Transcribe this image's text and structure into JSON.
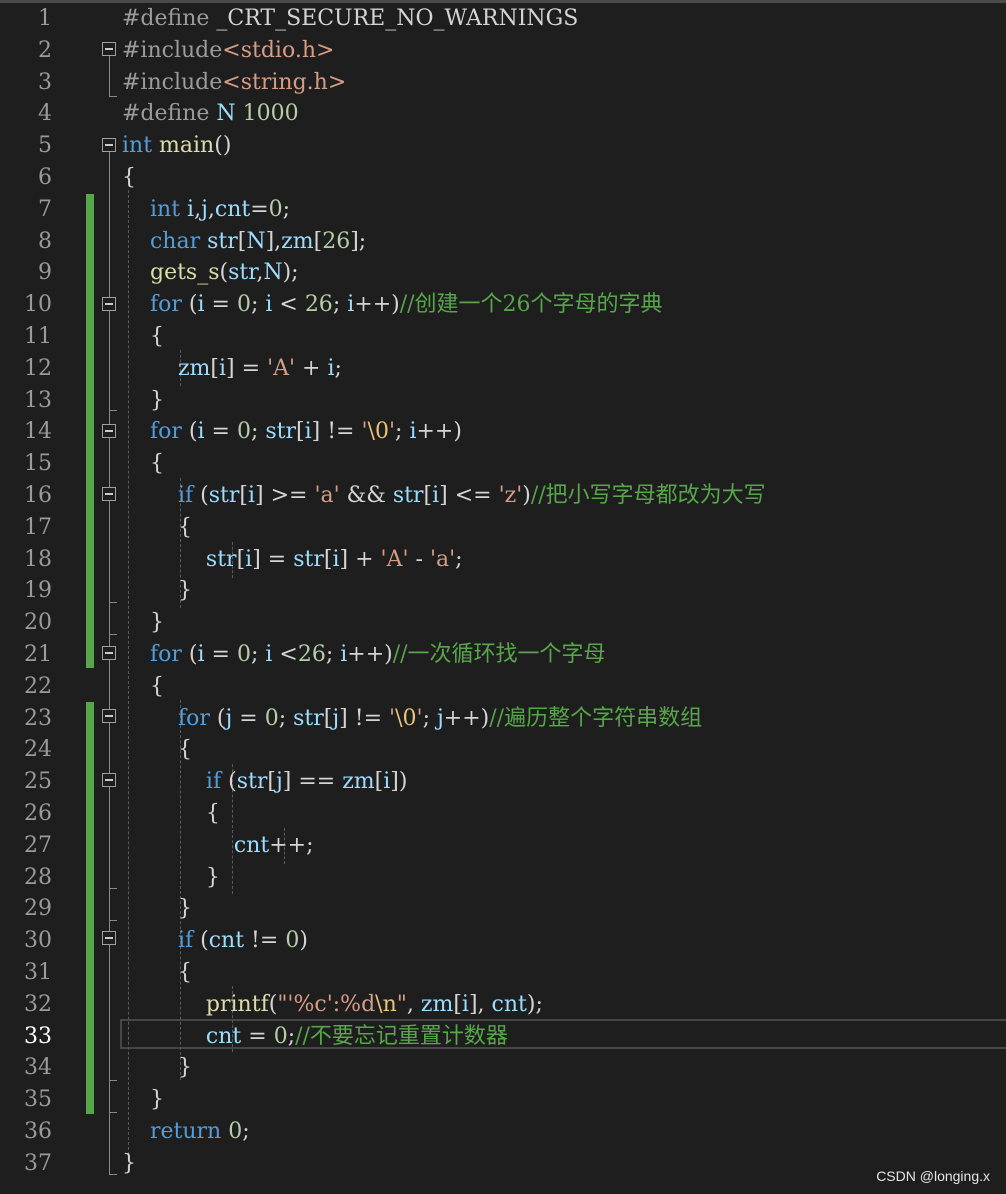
{
  "editor": {
    "current_line": 33,
    "lines": [
      {
        "num": "1",
        "tokens": [
          [
            "pp",
            "#define "
          ],
          [
            "op",
            "_CRT_SECURE_NO_WARNINGS"
          ]
        ]
      },
      {
        "num": "2",
        "tokens": [
          [
            "pp",
            "#include"
          ],
          [
            "str",
            "<stdio.h>"
          ]
        ]
      },
      {
        "num": "3",
        "tokens": [
          [
            "pp",
            "#include"
          ],
          [
            "str",
            "<string.h>"
          ]
        ]
      },
      {
        "num": "4",
        "tokens": [
          [
            "pp",
            "#define "
          ],
          [
            "var",
            "N"
          ],
          [
            "num",
            " 1000"
          ]
        ]
      },
      {
        "num": "5",
        "tokens": [
          [
            "kw",
            "int"
          ],
          [
            "fn",
            " main"
          ],
          [
            "op",
            "()"
          ]
        ]
      },
      {
        "num": "6",
        "tokens": [
          [
            "op",
            "{"
          ]
        ]
      },
      {
        "num": "7",
        "tokens": [
          [
            "op",
            "    "
          ],
          [
            "kw",
            "int"
          ],
          [
            "var",
            " i"
          ],
          [
            "op",
            ","
          ],
          [
            "var",
            "j"
          ],
          [
            "op",
            ","
          ],
          [
            "var",
            "cnt"
          ],
          [
            "op",
            "="
          ],
          [
            "num",
            "0"
          ],
          [
            "op",
            ";"
          ]
        ]
      },
      {
        "num": "8",
        "tokens": [
          [
            "op",
            "    "
          ],
          [
            "kw",
            "char"
          ],
          [
            "var",
            " str"
          ],
          [
            "op",
            "["
          ],
          [
            "var",
            "N"
          ],
          [
            "op",
            "],"
          ],
          [
            "var",
            "zm"
          ],
          [
            "op",
            "["
          ],
          [
            "num",
            "26"
          ],
          [
            "op",
            "];"
          ]
        ]
      },
      {
        "num": "9",
        "tokens": [
          [
            "op",
            "    "
          ],
          [
            "fn",
            "gets_s"
          ],
          [
            "op",
            "("
          ],
          [
            "var",
            "str"
          ],
          [
            "op",
            ","
          ],
          [
            "var",
            "N"
          ],
          [
            "op",
            ");"
          ]
        ]
      },
      {
        "num": "10",
        "tokens": [
          [
            "op",
            "    "
          ],
          [
            "kw",
            "for"
          ],
          [
            "op",
            " ("
          ],
          [
            "var",
            "i"
          ],
          [
            "op",
            " = "
          ],
          [
            "num",
            "0"
          ],
          [
            "op",
            "; "
          ],
          [
            "var",
            "i"
          ],
          [
            "op",
            " < "
          ],
          [
            "num",
            "26"
          ],
          [
            "op",
            "; "
          ],
          [
            "var",
            "i"
          ],
          [
            "op",
            "++)"
          ],
          [
            "cm",
            "//创建一个26个字母的字典"
          ]
        ]
      },
      {
        "num": "11",
        "tokens": [
          [
            "op",
            "    {"
          ]
        ]
      },
      {
        "num": "12",
        "tokens": [
          [
            "op",
            "        "
          ],
          [
            "var",
            "zm"
          ],
          [
            "op",
            "["
          ],
          [
            "var",
            "i"
          ],
          [
            "op",
            "] = "
          ],
          [
            "str",
            "'A'"
          ],
          [
            "op",
            " + "
          ],
          [
            "var",
            "i"
          ],
          [
            "op",
            ";"
          ]
        ]
      },
      {
        "num": "13",
        "tokens": [
          [
            "op",
            "    }"
          ]
        ]
      },
      {
        "num": "14",
        "tokens": [
          [
            "op",
            "    "
          ],
          [
            "kw",
            "for"
          ],
          [
            "op",
            " ("
          ],
          [
            "var",
            "i"
          ],
          [
            "op",
            " = "
          ],
          [
            "num",
            "0"
          ],
          [
            "op",
            "; "
          ],
          [
            "var",
            "str"
          ],
          [
            "op",
            "["
          ],
          [
            "var",
            "i"
          ],
          [
            "op",
            "] != "
          ],
          [
            "str",
            "'"
          ],
          [
            "esc",
            "\\0"
          ],
          [
            "str",
            "'"
          ],
          [
            "op",
            "; "
          ],
          [
            "var",
            "i"
          ],
          [
            "op",
            "++)"
          ]
        ]
      },
      {
        "num": "15",
        "tokens": [
          [
            "op",
            "    {"
          ]
        ]
      },
      {
        "num": "16",
        "tokens": [
          [
            "op",
            "        "
          ],
          [
            "kw",
            "if"
          ],
          [
            "op",
            " ("
          ],
          [
            "var",
            "str"
          ],
          [
            "op",
            "["
          ],
          [
            "var",
            "i"
          ],
          [
            "op",
            "] >= "
          ],
          [
            "str",
            "'a'"
          ],
          [
            "op",
            " && "
          ],
          [
            "var",
            "str"
          ],
          [
            "op",
            "["
          ],
          [
            "var",
            "i"
          ],
          [
            "op",
            "] <= "
          ],
          [
            "str",
            "'z'"
          ],
          [
            "op",
            ")"
          ],
          [
            "cm",
            "//把小写字母都改为大写"
          ]
        ]
      },
      {
        "num": "17",
        "tokens": [
          [
            "op",
            "        {"
          ]
        ]
      },
      {
        "num": "18",
        "tokens": [
          [
            "op",
            "            "
          ],
          [
            "var",
            "str"
          ],
          [
            "op",
            "["
          ],
          [
            "var",
            "i"
          ],
          [
            "op",
            "] = "
          ],
          [
            "var",
            "str"
          ],
          [
            "op",
            "["
          ],
          [
            "var",
            "i"
          ],
          [
            "op",
            "] + "
          ],
          [
            "str",
            "'A'"
          ],
          [
            "op",
            " - "
          ],
          [
            "str",
            "'a'"
          ],
          [
            "op",
            ";"
          ]
        ]
      },
      {
        "num": "19",
        "tokens": [
          [
            "op",
            "        }"
          ]
        ]
      },
      {
        "num": "20",
        "tokens": [
          [
            "op",
            "    }"
          ]
        ]
      },
      {
        "num": "21",
        "tokens": [
          [
            "op",
            "    "
          ],
          [
            "kw",
            "for"
          ],
          [
            "op",
            " ("
          ],
          [
            "var",
            "i"
          ],
          [
            "op",
            " = "
          ],
          [
            "num",
            "0"
          ],
          [
            "op",
            "; "
          ],
          [
            "var",
            "i"
          ],
          [
            "op",
            " <"
          ],
          [
            "num",
            "26"
          ],
          [
            "op",
            "; "
          ],
          [
            "var",
            "i"
          ],
          [
            "op",
            "++)"
          ],
          [
            "cm",
            "//一次循环找一个字母"
          ]
        ]
      },
      {
        "num": "22",
        "tokens": [
          [
            "op",
            "    {"
          ]
        ]
      },
      {
        "num": "23",
        "tokens": [
          [
            "op",
            "        "
          ],
          [
            "kw",
            "for"
          ],
          [
            "op",
            " ("
          ],
          [
            "var",
            "j"
          ],
          [
            "op",
            " = "
          ],
          [
            "num",
            "0"
          ],
          [
            "op",
            "; "
          ],
          [
            "var",
            "str"
          ],
          [
            "op",
            "["
          ],
          [
            "var",
            "j"
          ],
          [
            "op",
            "] != "
          ],
          [
            "str",
            "'"
          ],
          [
            "esc",
            "\\0"
          ],
          [
            "str",
            "'"
          ],
          [
            "op",
            "; "
          ],
          [
            "var",
            "j"
          ],
          [
            "op",
            "++)"
          ],
          [
            "cm",
            "//遍历整个字符串数组"
          ]
        ]
      },
      {
        "num": "24",
        "tokens": [
          [
            "op",
            "        {"
          ]
        ]
      },
      {
        "num": "25",
        "tokens": [
          [
            "op",
            "            "
          ],
          [
            "kw",
            "if"
          ],
          [
            "op",
            " ("
          ],
          [
            "var",
            "str"
          ],
          [
            "op",
            "["
          ],
          [
            "var",
            "j"
          ],
          [
            "op",
            "] == "
          ],
          [
            "var",
            "zm"
          ],
          [
            "op",
            "["
          ],
          [
            "var",
            "i"
          ],
          [
            "op",
            "])"
          ]
        ]
      },
      {
        "num": "26",
        "tokens": [
          [
            "op",
            "            {"
          ]
        ]
      },
      {
        "num": "27",
        "tokens": [
          [
            "op",
            "                "
          ],
          [
            "var",
            "cnt"
          ],
          [
            "op",
            "++;"
          ]
        ]
      },
      {
        "num": "28",
        "tokens": [
          [
            "op",
            "            }"
          ]
        ]
      },
      {
        "num": "29",
        "tokens": [
          [
            "op",
            "        }"
          ]
        ]
      },
      {
        "num": "30",
        "tokens": [
          [
            "op",
            "        "
          ],
          [
            "kw",
            "if"
          ],
          [
            "op",
            " ("
          ],
          [
            "var",
            "cnt"
          ],
          [
            "op",
            " != "
          ],
          [
            "num",
            "0"
          ],
          [
            "op",
            ")"
          ]
        ]
      },
      {
        "num": "31",
        "tokens": [
          [
            "op",
            "        {"
          ]
        ]
      },
      {
        "num": "32",
        "tokens": [
          [
            "op",
            "            "
          ],
          [
            "fn",
            "printf"
          ],
          [
            "op",
            "("
          ],
          [
            "str",
            "\"'%c':%d"
          ],
          [
            "esc",
            "\\n"
          ],
          [
            "str",
            "\""
          ],
          [
            "op",
            ", "
          ],
          [
            "var",
            "zm"
          ],
          [
            "op",
            "["
          ],
          [
            "var",
            "i"
          ],
          [
            "op",
            "], "
          ],
          [
            "var",
            "cnt"
          ],
          [
            "op",
            ");"
          ]
        ]
      },
      {
        "num": "33",
        "tokens": [
          [
            "op",
            "            "
          ],
          [
            "var",
            "cnt"
          ],
          [
            "op",
            " = "
          ],
          [
            "num",
            "0"
          ],
          [
            "op",
            ";"
          ],
          [
            "cm",
            "//不要忘记重置计数器"
          ]
        ]
      },
      {
        "num": "34",
        "tokens": [
          [
            "op",
            "        }"
          ]
        ]
      },
      {
        "num": "35",
        "tokens": [
          [
            "op",
            "    }"
          ]
        ]
      },
      {
        "num": "36",
        "tokens": [
          [
            "op",
            "    "
          ],
          [
            "kw",
            "return"
          ],
          [
            "num",
            " 0"
          ],
          [
            "op",
            ";"
          ]
        ]
      },
      {
        "num": "37",
        "tokens": [
          [
            "op",
            "}"
          ]
        ]
      }
    ]
  },
  "watermark": "CSDN @longing.x",
  "colors": {
    "background": "#1e1e1e",
    "keyword": "#569cd6",
    "string": "#d69d85",
    "comment": "#57a64a",
    "number": "#b5cea8",
    "changed_bar": "#57a64a"
  }
}
